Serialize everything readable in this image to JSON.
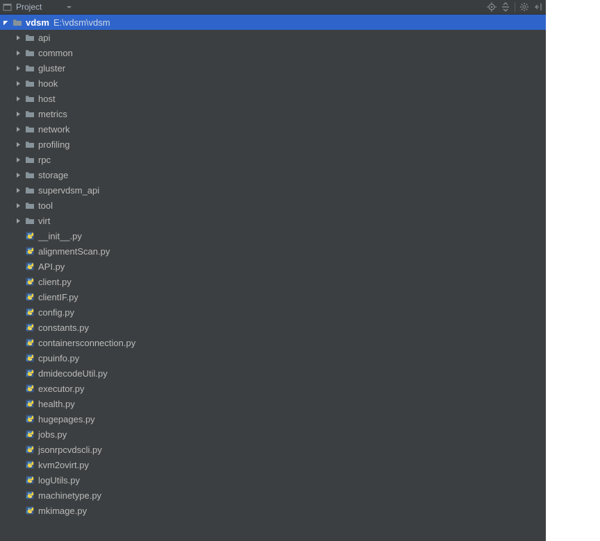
{
  "toolbar": {
    "title": "Project"
  },
  "root": {
    "name": "vdsm",
    "path": "E:\\vdsm\\vdsm"
  },
  "folders": [
    {
      "name": "api"
    },
    {
      "name": "common"
    },
    {
      "name": "gluster"
    },
    {
      "name": "hook"
    },
    {
      "name": "host"
    },
    {
      "name": "metrics"
    },
    {
      "name": "network"
    },
    {
      "name": "profiling"
    },
    {
      "name": "rpc"
    },
    {
      "name": "storage"
    },
    {
      "name": "supervdsm_api"
    },
    {
      "name": "tool"
    },
    {
      "name": "virt"
    }
  ],
  "files": [
    {
      "name": "__init__.py"
    },
    {
      "name": "alignmentScan.py"
    },
    {
      "name": "API.py"
    },
    {
      "name": "client.py"
    },
    {
      "name": "clientIF.py"
    },
    {
      "name": "config.py"
    },
    {
      "name": "constants.py"
    },
    {
      "name": "containersconnection.py"
    },
    {
      "name": "cpuinfo.py"
    },
    {
      "name": "dmidecodeUtil.py"
    },
    {
      "name": "executor.py"
    },
    {
      "name": "health.py"
    },
    {
      "name": "hugepages.py"
    },
    {
      "name": "jobs.py"
    },
    {
      "name": "jsonrpcvdscli.py"
    },
    {
      "name": "kvm2ovirt.py"
    },
    {
      "name": "logUtils.py"
    },
    {
      "name": "machinetype.py"
    },
    {
      "name": "mkimage.py"
    }
  ]
}
